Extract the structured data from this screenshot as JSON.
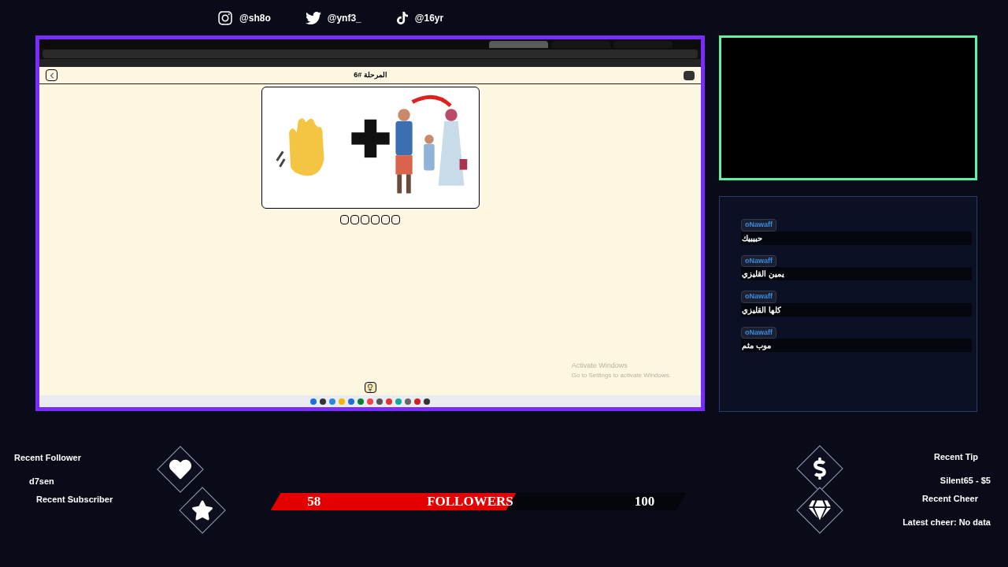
{
  "socials": [
    {
      "kind": "instagram",
      "handle": "@sh8o"
    },
    {
      "kind": "twitter",
      "handle": "@ynf3_"
    },
    {
      "kind": "tiktok",
      "handle": "@16yr"
    }
  ],
  "browser": {
    "tabs": [
      {
        "selected": true
      },
      {
        "selected": false
      },
      {
        "selected": false
      }
    ],
    "page_title": "المرحلة #6",
    "activation": {
      "title": "Activate Windows",
      "subtitle": "Go to Settings to activate Windows."
    }
  },
  "chat": [
    {
      "user": "oNawaff",
      "message": "حبيبيك"
    },
    {
      "user": "oNawaff",
      "message": "يمين القليزي"
    },
    {
      "user": "oNawaff",
      "message": "كلها القليزي"
    },
    {
      "user": "oNawaff",
      "message": "موب مثم"
    }
  ],
  "alerts_left": [
    {
      "kind": "heart",
      "label": "Recent Follower",
      "value": "d7sen"
    },
    {
      "kind": "star",
      "label": "Recent Subscriber"
    }
  ],
  "alerts_right": [
    {
      "kind": "dollar",
      "label": "Recent Tip",
      "value": "Silent65 - $5"
    },
    {
      "kind": "diamond",
      "label": "Recent Cheer",
      "value": "Latest cheer: No data"
    }
  ],
  "followers_goal": {
    "current": "58",
    "label": "FOLLOWERS",
    "target": "100",
    "level": 0.58
  }
}
